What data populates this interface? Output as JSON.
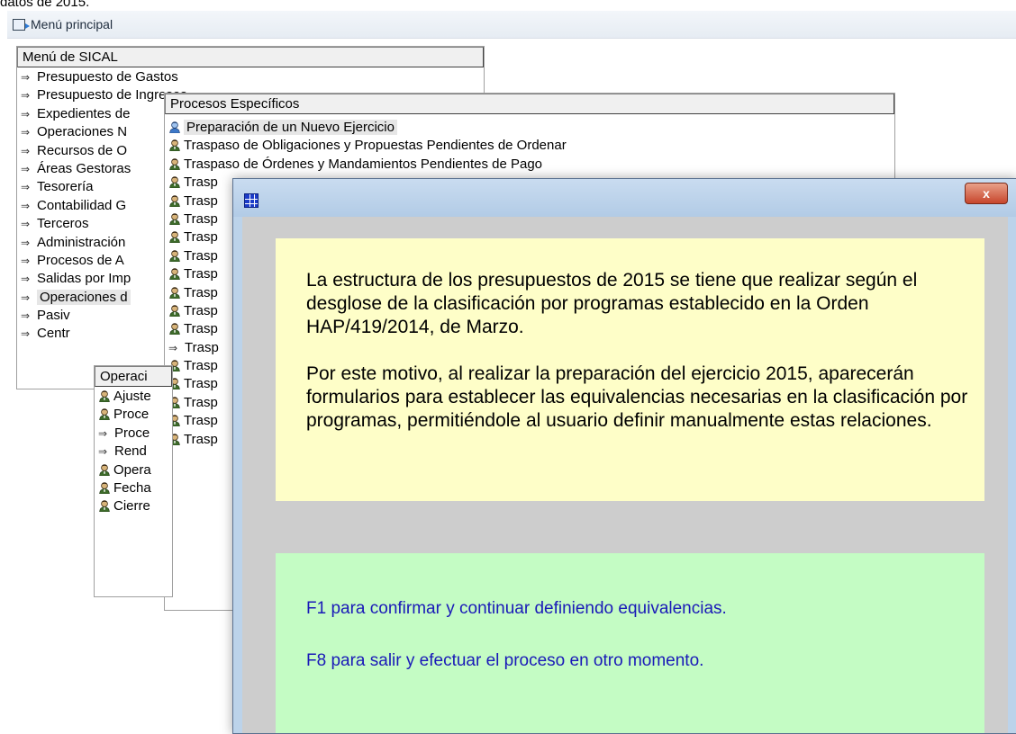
{
  "top_caption": "datos de 2015.",
  "window": {
    "title": "Menú principal"
  },
  "main_menu": {
    "header": "Menú de SICAL",
    "items": [
      {
        "label": "Presupuesto de Gastos",
        "icon": "arrow-icon"
      },
      {
        "label": "Presupuesto de Ingresos",
        "icon": "arrow-icon"
      },
      {
        "label": "Expedientes de",
        "icon": "arrow-icon"
      },
      {
        "label": "Operaciones N",
        "icon": "arrow-icon"
      },
      {
        "label": "Recursos de O",
        "icon": "arrow-icon"
      },
      {
        "label": "Áreas Gestoras",
        "icon": "arrow-icon"
      },
      {
        "label": "Tesorería",
        "icon": "arrow-icon"
      },
      {
        "label": "Contabilidad G",
        "icon": "arrow-icon"
      },
      {
        "label": "Terceros",
        "icon": "arrow-icon"
      },
      {
        "label": "Administración",
        "icon": "arrow-icon"
      },
      {
        "label": "Procesos de A",
        "icon": "arrow-icon"
      },
      {
        "label": "Salidas por Imp",
        "icon": "arrow-icon"
      },
      {
        "label": "Operaciones d",
        "icon": "arrow-icon",
        "selected": true
      },
      {
        "label": "Pasiv",
        "icon": "arrow-icon"
      },
      {
        "label": "Centr",
        "icon": "arrow-icon"
      }
    ]
  },
  "operaciones_menu": {
    "header": "Operaci",
    "items": [
      {
        "label": "Ajuste",
        "icon": "person-icon"
      },
      {
        "label": "Proce",
        "icon": "person-icon"
      },
      {
        "label": "Proce",
        "icon": "arrow-icon"
      },
      {
        "label": "Rend",
        "icon": "arrow-icon"
      },
      {
        "label": "Opera",
        "icon": "person-icon"
      },
      {
        "label": "Fecha",
        "icon": "person-icon"
      },
      {
        "label": "Cierre",
        "icon": "person-icon"
      }
    ]
  },
  "procesos_menu": {
    "header": "Procesos Específicos",
    "items": [
      {
        "label": "Preparación de un Nuevo Ejercicio",
        "icon": "person-icon",
        "selected": true
      },
      {
        "label": "Traspaso de Obligaciones y Propuestas Pendientes de Ordenar",
        "icon": "person-icon"
      },
      {
        "label": "Traspaso de Órdenes y Mandamientos Pendientes de Pago",
        "icon": "person-icon"
      },
      {
        "label": "Trasp",
        "icon": "person-icon"
      },
      {
        "label": "Trasp",
        "icon": "person-icon"
      },
      {
        "label": "Trasp",
        "icon": "person-icon"
      },
      {
        "label": "Trasp",
        "icon": "person-icon"
      },
      {
        "label": "Trasp",
        "icon": "person-icon"
      },
      {
        "label": "Trasp",
        "icon": "person-icon"
      },
      {
        "label": "Trasp",
        "icon": "person-icon"
      },
      {
        "label": "Trasp",
        "icon": "person-icon"
      },
      {
        "label": "Trasp",
        "icon": "person-icon"
      },
      {
        "label": "Trasp",
        "icon": "arrow-icon"
      },
      {
        "label": "Trasp",
        "icon": "person-icon"
      },
      {
        "label": "Trasp",
        "icon": "person-icon"
      },
      {
        "label": "Trasp",
        "icon": "person-icon"
      },
      {
        "label": "Trasp",
        "icon": "person-icon"
      },
      {
        "label": "Trasp",
        "icon": "person-icon"
      }
    ]
  },
  "dialog": {
    "close_label": "x",
    "info_paragraphs": [
      "La estructura de los presupuestos de 2015 se tiene que realizar según el desglose de la clasificación por programas establecido en la Orden HAP/419/2014, de Marzo.",
      "Por este motivo, al realizar la preparación del ejercicio 2015, aparecerán formularios para establecer las equivalencias necesarias en la clasificación por programas, permitiéndole al usuario definir manualmente estas relaciones."
    ],
    "actions": [
      "F1 para confirmar y continuar definiendo equivalencias.",
      "F8 para salir y efectuar el proceso en otro momento."
    ]
  },
  "colors": {
    "info_bg": "#fefec8",
    "action_bg": "#c4fcc4",
    "action_text": "#1a1ab8",
    "dialog_frame": "#bcd3ea"
  }
}
